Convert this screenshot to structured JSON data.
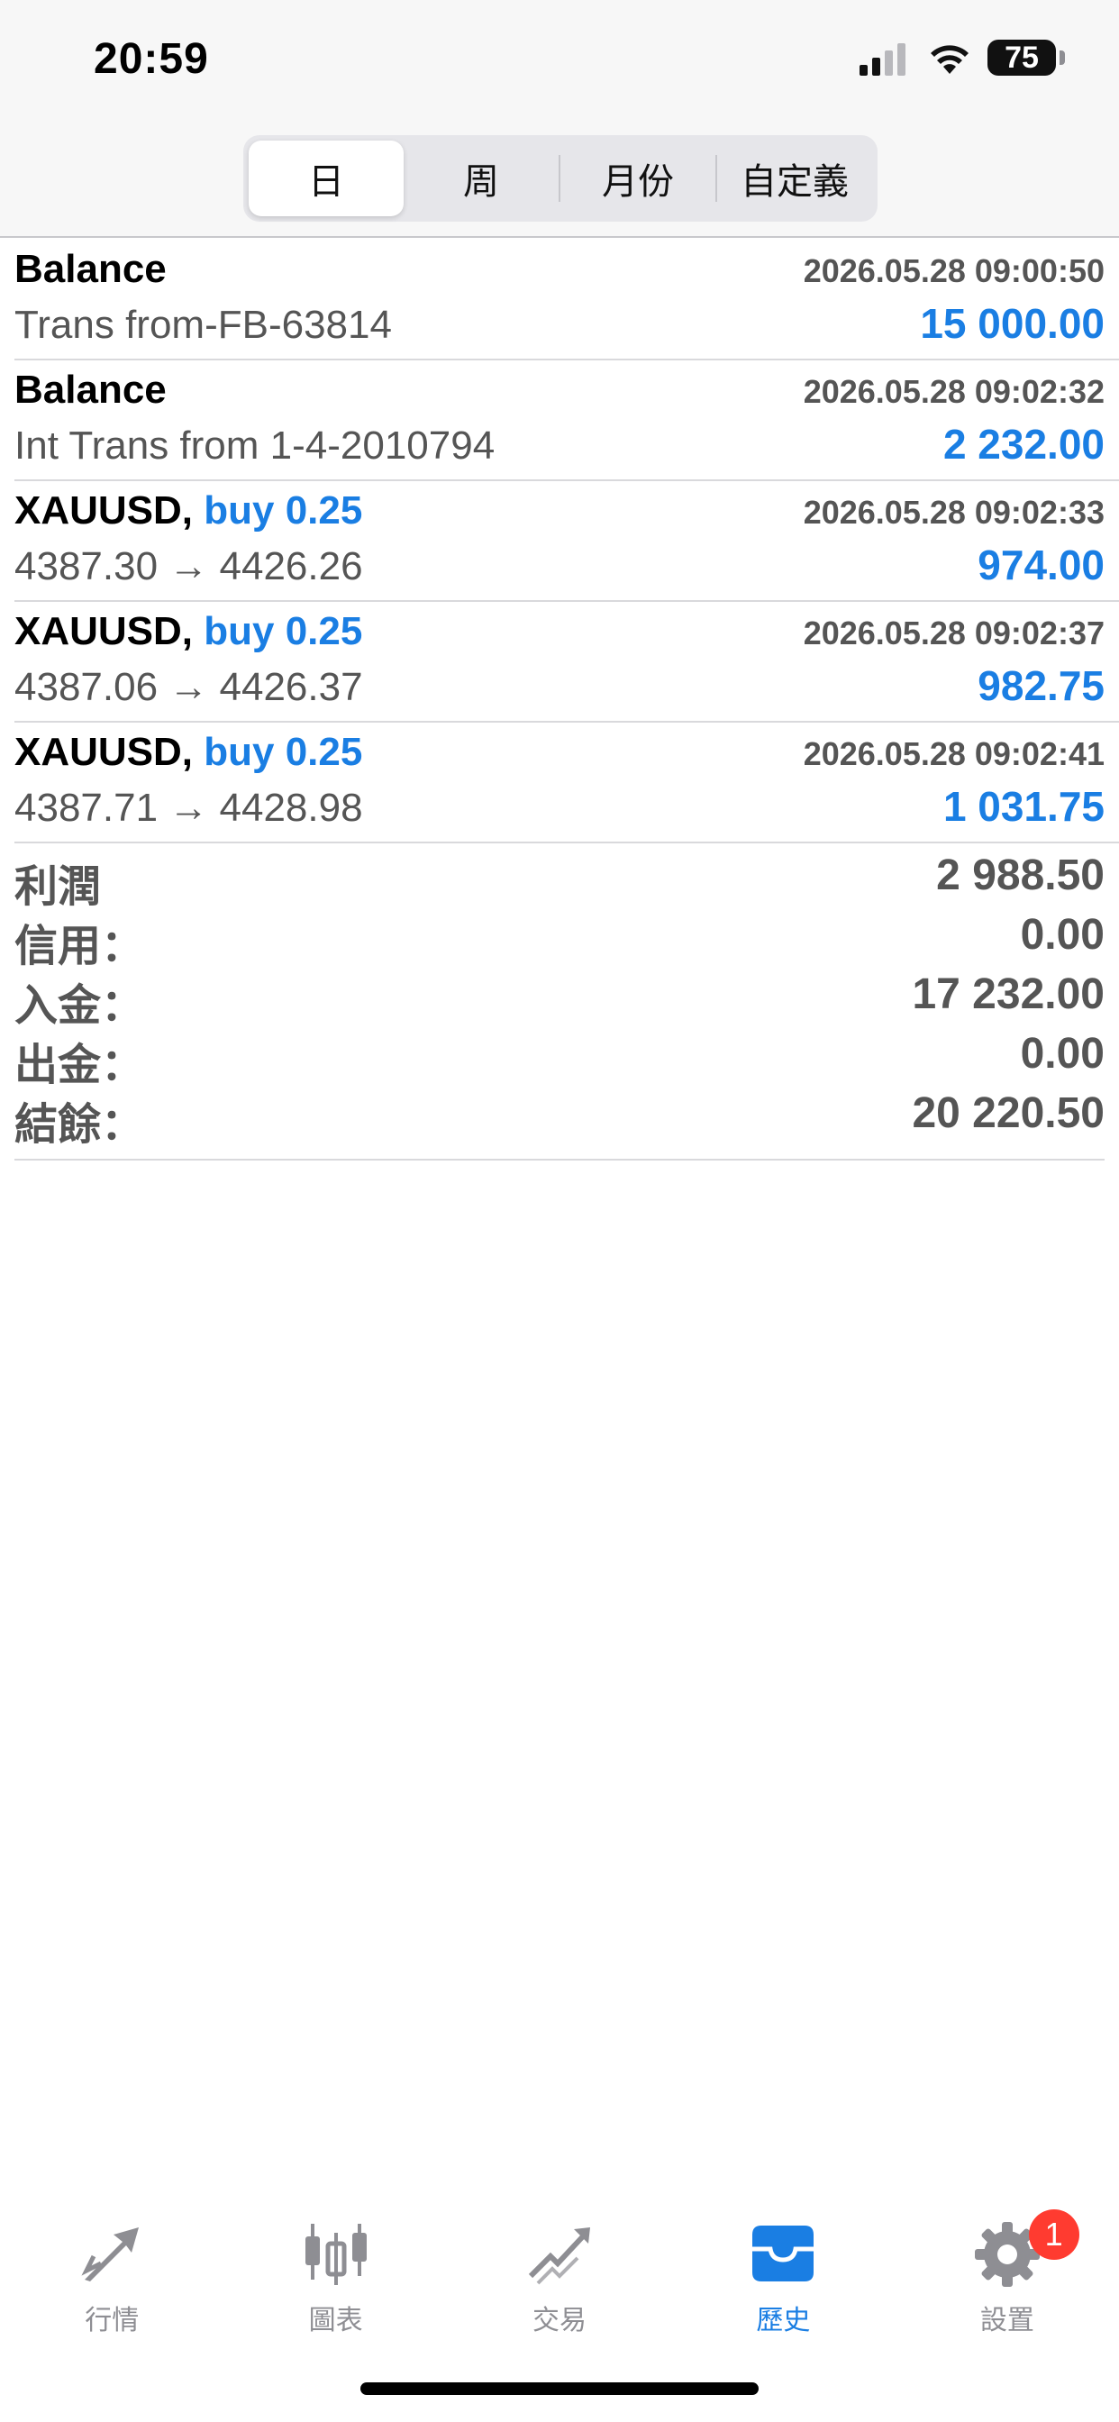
{
  "status_bar": {
    "time": "20:59",
    "battery": "75"
  },
  "segments": [
    "日",
    "周",
    "月份",
    "自定義"
  ],
  "active_segment": 0,
  "rows": [
    {
      "title": "Balance",
      "side": "",
      "date": "2026.05.28 09:00:50",
      "desc": "Trans from-FB-63814",
      "amount": "15 000.00"
    },
    {
      "title": "Balance",
      "side": "",
      "date": "2026.05.28 09:02:32",
      "desc": "Int Trans from 1-4-2010794",
      "amount": "2 232.00"
    },
    {
      "title": "XAUUSD,",
      "side": "buy 0.25",
      "date": "2026.05.28 09:02:33",
      "desc": "4387.30 → 4426.26",
      "amount": "974.00"
    },
    {
      "title": "XAUUSD,",
      "side": "buy 0.25",
      "date": "2026.05.28 09:02:37",
      "desc": "4387.06 → 4426.37",
      "amount": "982.75"
    },
    {
      "title": "XAUUSD,",
      "side": "buy 0.25",
      "date": "2026.05.28 09:02:41",
      "desc": "4387.71 → 4428.98",
      "amount": "1 031.75"
    }
  ],
  "summary": [
    {
      "label": "利潤",
      "value": "2 988.50"
    },
    {
      "label": "信用：",
      "value": "0.00"
    },
    {
      "label": "入金：",
      "value": "17 232.00"
    },
    {
      "label": "出金：",
      "value": "0.00"
    },
    {
      "label": "結餘：",
      "value": "20 220.50"
    }
  ],
  "tabs": [
    {
      "label": "行情",
      "icon": "quotes-icon"
    },
    {
      "label": "圖表",
      "icon": "chart-icon"
    },
    {
      "label": "交易",
      "icon": "trade-icon"
    },
    {
      "label": "歷史",
      "icon": "history-icon"
    },
    {
      "label": "設置",
      "icon": "settings-icon"
    }
  ],
  "active_tab": 3,
  "settings_badge": "1",
  "colors": {
    "accent": "#1a7ee3",
    "badge": "#ff3b30",
    "muted": "#8e8e93"
  }
}
